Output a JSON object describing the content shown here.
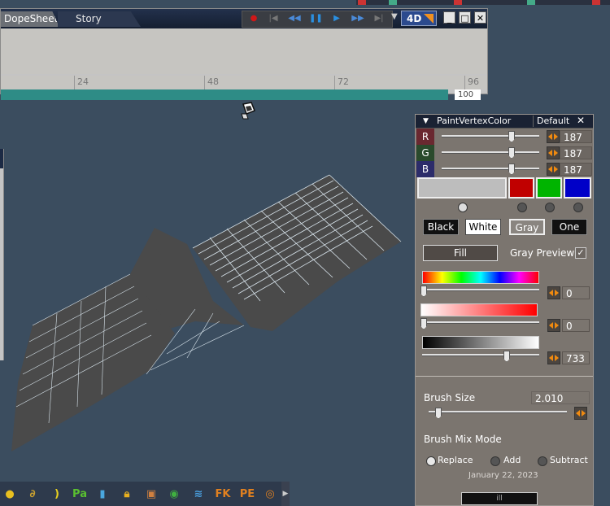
{
  "timeline": {
    "tabs": [
      "DopeSheet",
      "Story"
    ],
    "mode_button": "4D",
    "ruler_ticks": [
      "24",
      "48",
      "72",
      "96"
    ],
    "end_frame": "100"
  },
  "paint_panel": {
    "title": "PaintVertexColor",
    "preset": "Default",
    "channels": [
      {
        "label": "R",
        "value": "187",
        "color": "#6a2830"
      },
      {
        "label": "G",
        "value": "187",
        "color": "#2a4a2c"
      },
      {
        "label": "B",
        "value": "187",
        "color": "#2c2c6a"
      }
    ],
    "swatches": [
      "#bdbdbd",
      "#c00000",
      "#00b400",
      "#0000c8"
    ],
    "presets": [
      "Black",
      "White",
      "Gray",
      "One"
    ],
    "fill_label": "Fill",
    "gray_preview_label": "Gray Preview",
    "hue_value": "0",
    "saturation_value": "0",
    "value_value": "733",
    "brush_size_label": "Brush Size",
    "brush_size_value": "2.010",
    "brush_mix_label": "Brush Mix Mode",
    "mix_modes": [
      "Replace",
      "Add",
      "Subtract"
    ],
    "date": "January 22, 2023",
    "footer": "ill"
  },
  "toolbar": {
    "icons": [
      "FK",
      "PE",
      "Pa"
    ]
  },
  "colors": {
    "background": "#3b4d5f",
    "panel": "#7b756f",
    "accent": "#f08a10",
    "timeline_bar": "#2e8c86"
  }
}
